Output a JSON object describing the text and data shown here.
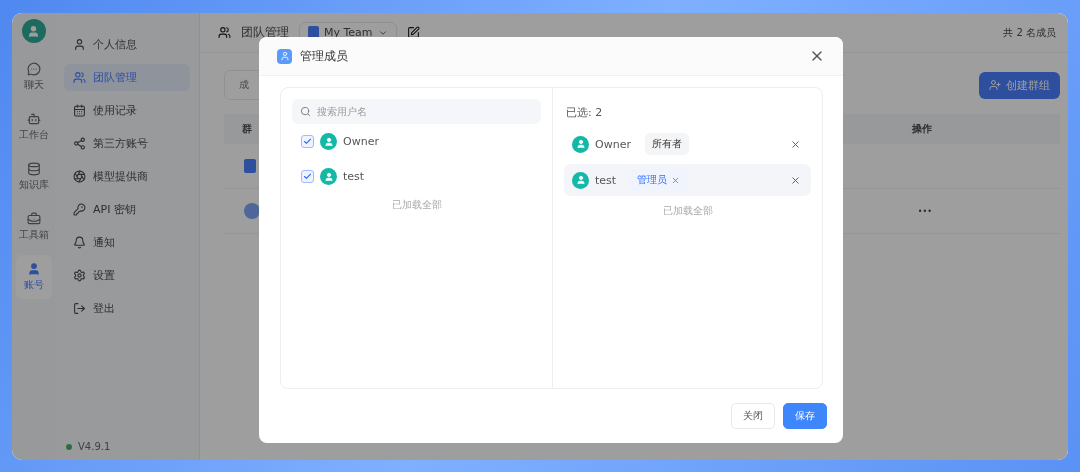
{
  "nav_rail": {
    "items": [
      {
        "label": "聊天",
        "selected": false
      },
      {
        "label": "工作台",
        "selected": false
      },
      {
        "label": "知识库",
        "selected": false
      },
      {
        "label": "工具箱",
        "selected": false
      },
      {
        "label": "账号",
        "selected": true
      }
    ]
  },
  "sidebar": {
    "items": [
      {
        "label": "个人信息",
        "selected": false
      },
      {
        "label": "团队管理",
        "selected": true
      },
      {
        "label": "使用记录",
        "selected": false
      },
      {
        "label": "第三方账号",
        "selected": false
      },
      {
        "label": "模型提供商",
        "selected": false
      },
      {
        "label": "API 密钥",
        "selected": false
      },
      {
        "label": "通知",
        "selected": false
      },
      {
        "label": "设置",
        "selected": false
      },
      {
        "label": "登出",
        "selected": false
      }
    ],
    "version": "V4.9.1"
  },
  "header": {
    "title": "团队管理",
    "team": "My Team",
    "member_count": "共 2 名成员"
  },
  "content": {
    "tab": "成",
    "create_button": "创建群组",
    "columns": [
      "群",
      "操作"
    ],
    "row_action": "•••"
  },
  "dialog": {
    "title": "管理成员",
    "search": {
      "placeholder": "搜索用户名"
    },
    "members": [
      {
        "name": "Owner",
        "checked": true
      },
      {
        "name": "test",
        "checked": true
      }
    ],
    "members_footer": "已加载全部",
    "selected_label": "已选: 2",
    "selected": [
      {
        "name": "Owner",
        "role": "所有者",
        "removable_role": false,
        "highlighted": false
      },
      {
        "name": "test",
        "role": "管理员",
        "removable_role": true,
        "highlighted": true
      }
    ],
    "selected_footer": "已加载全部",
    "buttons": [
      {
        "label": "关闭",
        "kind": "secondary"
      },
      {
        "label": "保存",
        "kind": "primary"
      }
    ]
  }
}
